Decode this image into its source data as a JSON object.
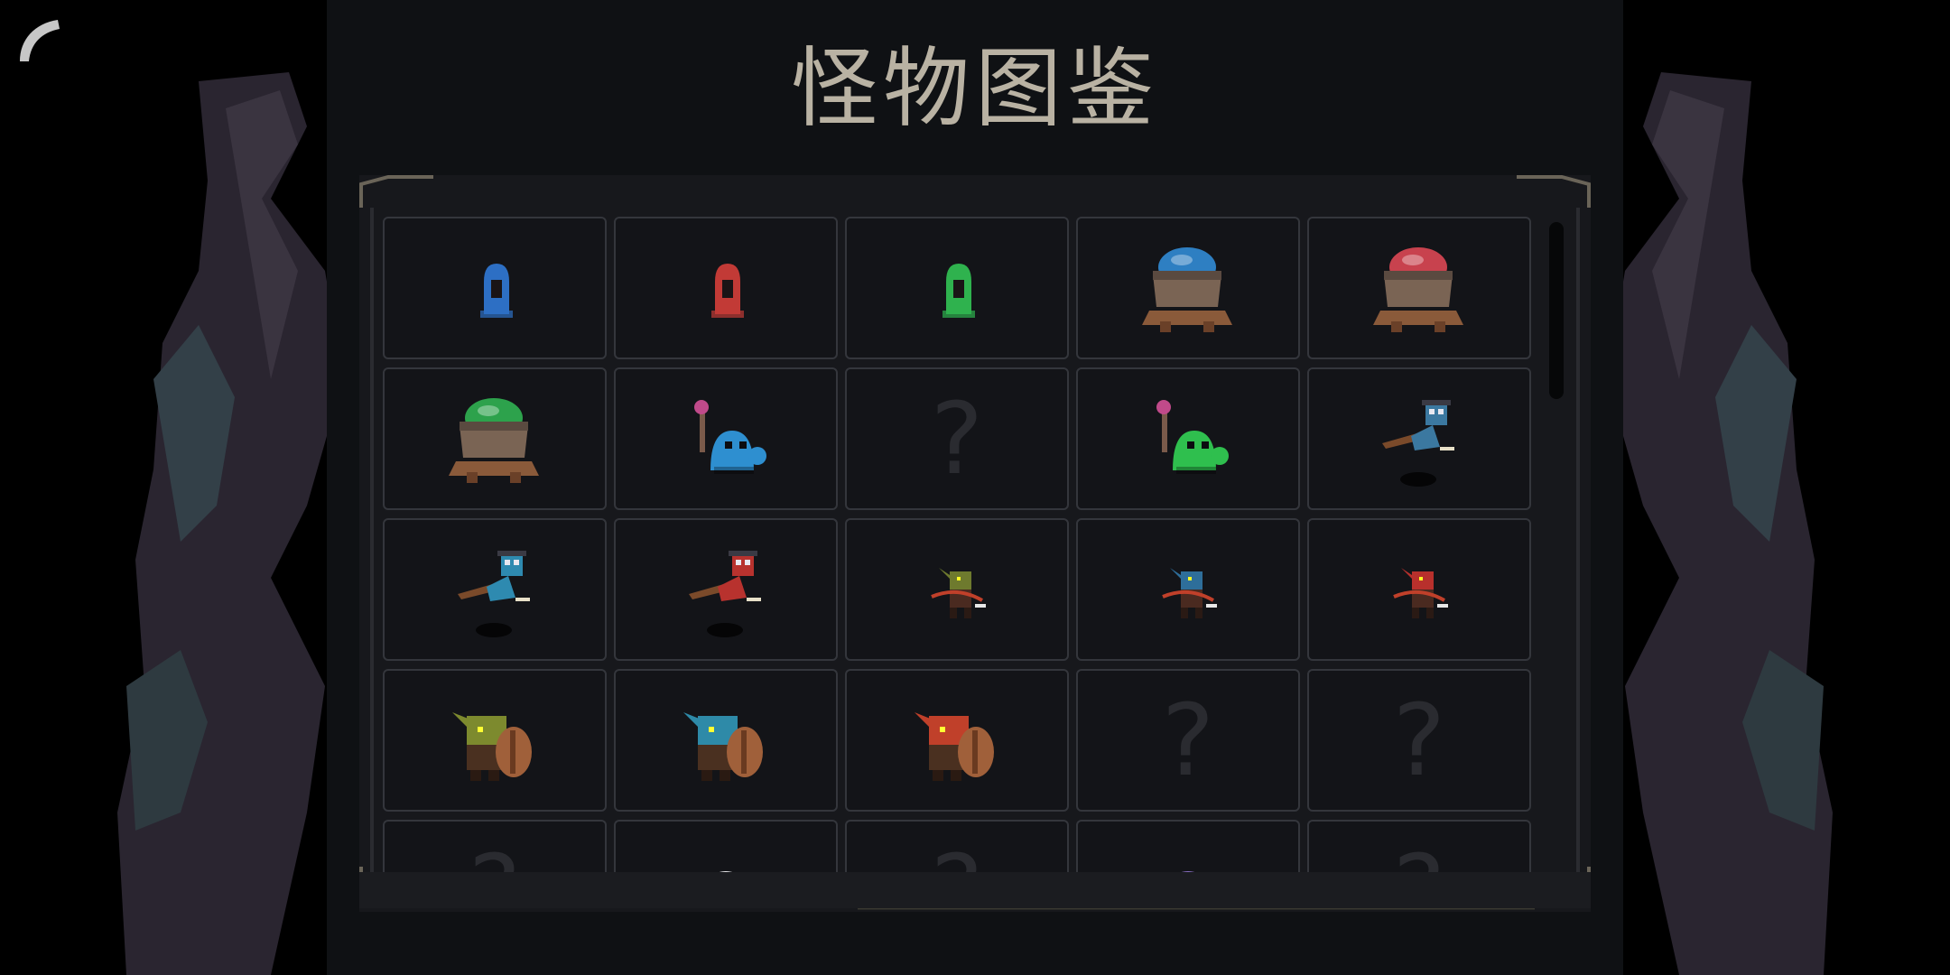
{
  "title": "怪物图鉴",
  "back_icon": "back-arrow-icon",
  "colors": {
    "panel": "#0f1114",
    "frame": "#17181c",
    "cell_border": "#34363c",
    "title": "#b9b2a3",
    "unknown": "#2a2b30"
  },
  "monsters": [
    {
      "icon": "blue-slime-icon",
      "color": "#2d6fc4",
      "type": "slime"
    },
    {
      "icon": "red-slime-icon",
      "color": "#c23a36",
      "type": "slime"
    },
    {
      "icon": "green-slime-icon",
      "color": "#2fb24e",
      "type": "slime"
    },
    {
      "icon": "blue-cauldron-slime-icon",
      "color": "#2e7fc2",
      "type": "cauldron"
    },
    {
      "icon": "red-cauldron-slime-icon",
      "color": "#c8424e",
      "type": "cauldron"
    },
    {
      "icon": "green-cauldron-slime-icon",
      "color": "#2da24c",
      "type": "cauldron"
    },
    {
      "icon": "blue-slime-mage-icon",
      "color": "#2e8fd0",
      "type": "mage"
    },
    {
      "icon": "unknown-monster-icon",
      "unknown": true,
      "label": "?"
    },
    {
      "icon": "green-slime-mage-icon",
      "color": "#2fbf4e",
      "type": "mage"
    },
    {
      "icon": "blue-goblin-witch-icon",
      "color": "#3b78a0",
      "type": "witch"
    },
    {
      "icon": "blue-goblin-witch-icon",
      "color": "#2e8ab0",
      "type": "witch"
    },
    {
      "icon": "red-goblin-witch-icon",
      "color": "#b8322e",
      "type": "witch"
    },
    {
      "icon": "green-goblin-archer-icon",
      "color": "#6e7a2e",
      "type": "archer"
    },
    {
      "icon": "blue-goblin-archer-icon",
      "color": "#2e6e9a",
      "type": "archer"
    },
    {
      "icon": "red-goblin-archer-icon",
      "color": "#b8302c",
      "type": "archer"
    },
    {
      "icon": "green-goblin-shield-icon",
      "color": "#7d8a2e",
      "type": "shield"
    },
    {
      "icon": "blue-goblin-shield-icon",
      "color": "#2e8aa8",
      "type": "shield"
    },
    {
      "icon": "red-goblin-shield-icon",
      "color": "#c0402a",
      "type": "shield"
    },
    {
      "icon": "unknown-monster-icon",
      "unknown": true,
      "label": "?"
    },
    {
      "icon": "unknown-monster-icon",
      "unknown": true,
      "label": "?"
    },
    {
      "icon": "unknown-monster-icon",
      "unknown": true,
      "label": "?"
    },
    {
      "icon": "white-hooded-monster-icon",
      "color": "#e8e8ec",
      "type": "hood"
    },
    {
      "icon": "unknown-monster-icon",
      "unknown": true,
      "label": "?"
    },
    {
      "icon": "purple-hooded-monster-icon",
      "color": "#8a6fc4",
      "type": "hood"
    },
    {
      "icon": "unknown-monster-icon",
      "unknown": true,
      "label": "?"
    }
  ]
}
